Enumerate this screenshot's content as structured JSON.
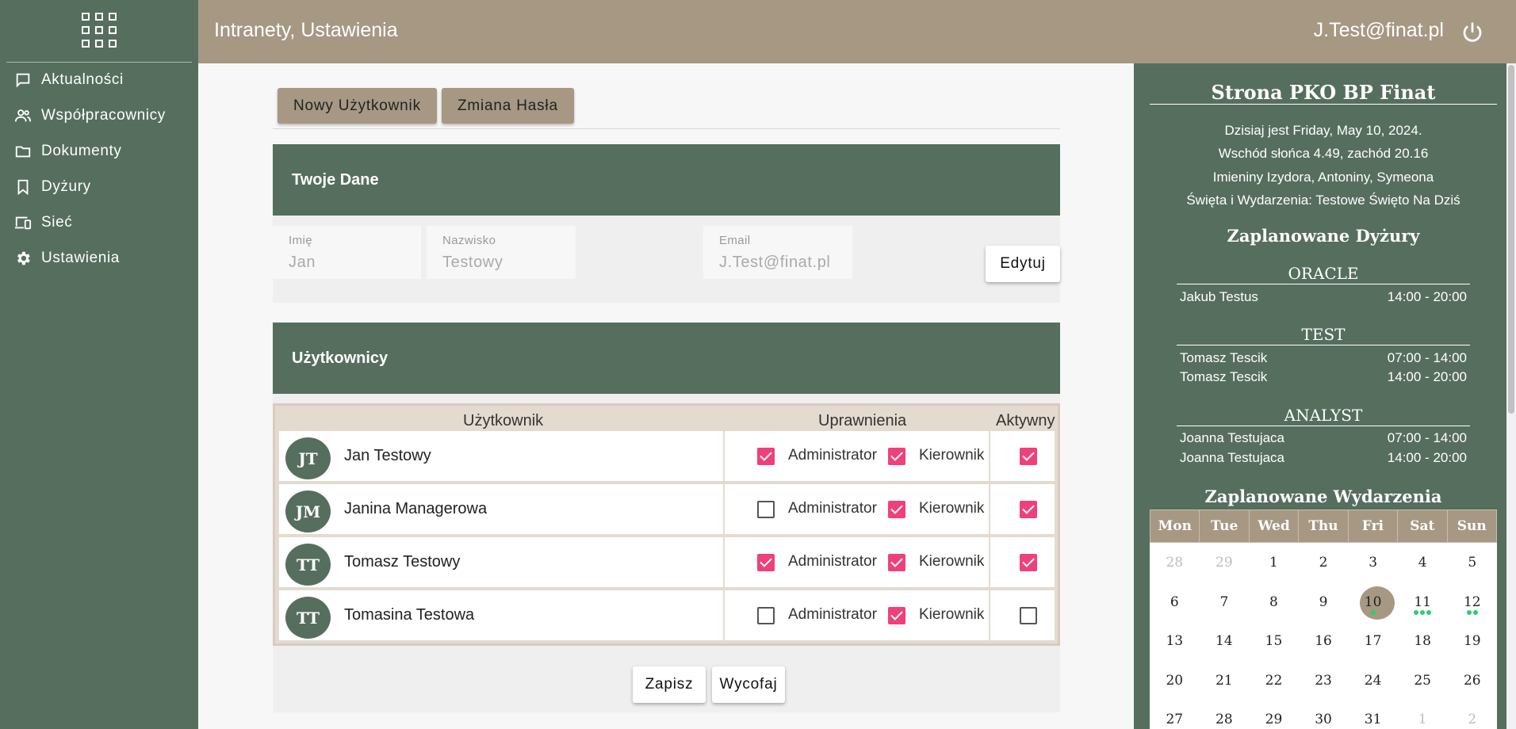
{
  "sidebar": {
    "items": [
      {
        "label": "Aktualności",
        "icon": "chat-icon"
      },
      {
        "label": "Współpracownicy",
        "icon": "people-icon"
      },
      {
        "label": "Dokumenty",
        "icon": "folder-icon"
      },
      {
        "label": "Dyżury",
        "icon": "bookmark-icon"
      },
      {
        "label": "Sieć",
        "icon": "devices-icon"
      },
      {
        "label": "Ustawienia",
        "icon": "gear-icon"
      }
    ]
  },
  "header": {
    "title": "Intranety, Ustawienia",
    "user": "J.Test@finat.pl"
  },
  "tabs": {
    "new_user": "Nowy Użytkownik",
    "change_password": "Zmiana Hasła"
  },
  "profile": {
    "title": "Twoje Dane",
    "first_name_label": "Imię",
    "first_name": "Jan",
    "last_name_label": "Nazwisko",
    "last_name": "Testowy",
    "email_label": "Email",
    "email": "J.Test@finat.pl",
    "edit_button": "Edytuj"
  },
  "users": {
    "title": "Użytkownicy",
    "columns": {
      "user": "Użytkownik",
      "permissions": "Uprawnienia",
      "active": "Aktywny"
    },
    "admin_label": "Administrator",
    "manager_label": "Kierownik",
    "rows": [
      {
        "initials": "JT",
        "name": "Jan Testowy",
        "admin": true,
        "manager": true,
        "active": true
      },
      {
        "initials": "JM",
        "name": "Janina Managerowa",
        "admin": false,
        "manager": true,
        "active": true
      },
      {
        "initials": "TT",
        "name": "Tomasz Testowy",
        "admin": true,
        "manager": true,
        "active": true
      },
      {
        "initials": "TT",
        "name": "Tomasina Testowa",
        "admin": false,
        "manager": true,
        "active": false
      }
    ],
    "save_button": "Zapisz",
    "revert_button": "Wycofaj"
  },
  "panel": {
    "title": "Strona PKO BP Finat",
    "info": [
      "Dzisiaj jest Friday, May 10, 2024.",
      "Wschód słońca 4.49, zachód 20.16",
      "Imieniny Izydora, Antoniny, Symeona",
      "Święta i Wydarzenia: Testowe Święto Na Dziś"
    ],
    "shifts_title": "Zaplanowane Dyżury",
    "shift_groups": [
      {
        "name": "ORACLE",
        "entries": [
          {
            "person": "Jakub Testus",
            "time": "14:00 - 20:00"
          }
        ]
      },
      {
        "name": "TEST",
        "entries": [
          {
            "person": "Tomasz Tescik",
            "time": "07:00 - 14:00"
          },
          {
            "person": "Tomasz Tescik",
            "time": "14:00 - 20:00"
          }
        ]
      },
      {
        "name": "ANALYST",
        "entries": [
          {
            "person": "Joanna Testujaca",
            "time": "07:00 - 14:00"
          },
          {
            "person": "Joanna Testujaca",
            "time": "14:00 - 20:00"
          }
        ]
      }
    ],
    "events_title": "Zaplanowane Wydarzenia",
    "calendar": {
      "weekdays": [
        "Mon",
        "Tue",
        "Wed",
        "Thu",
        "Fri",
        "Sat",
        "Sun"
      ],
      "weeks": [
        [
          {
            "d": "28",
            "muted": true
          },
          {
            "d": "29",
            "muted": true
          },
          {
            "d": "1"
          },
          {
            "d": "2"
          },
          {
            "d": "3"
          },
          {
            "d": "4"
          },
          {
            "d": "5"
          }
        ],
        [
          {
            "d": "6"
          },
          {
            "d": "7"
          },
          {
            "d": "8"
          },
          {
            "d": "9"
          },
          {
            "d": "10",
            "today": true,
            "events": 1
          },
          {
            "d": "11",
            "events": 3
          },
          {
            "d": "12",
            "events": 2
          }
        ],
        [
          {
            "d": "13"
          },
          {
            "d": "14"
          },
          {
            "d": "15"
          },
          {
            "d": "16"
          },
          {
            "d": "17"
          },
          {
            "d": "18"
          },
          {
            "d": "19"
          }
        ],
        [
          {
            "d": "20"
          },
          {
            "d": "21"
          },
          {
            "d": "22"
          },
          {
            "d": "23"
          },
          {
            "d": "24"
          },
          {
            "d": "25"
          },
          {
            "d": "26"
          }
        ],
        [
          {
            "d": "27"
          },
          {
            "d": "28"
          },
          {
            "d": "29"
          },
          {
            "d": "30"
          },
          {
            "d": "31"
          },
          {
            "d": "1",
            "muted": true
          },
          {
            "d": "2",
            "muted": true
          }
        ]
      ]
    }
  }
}
